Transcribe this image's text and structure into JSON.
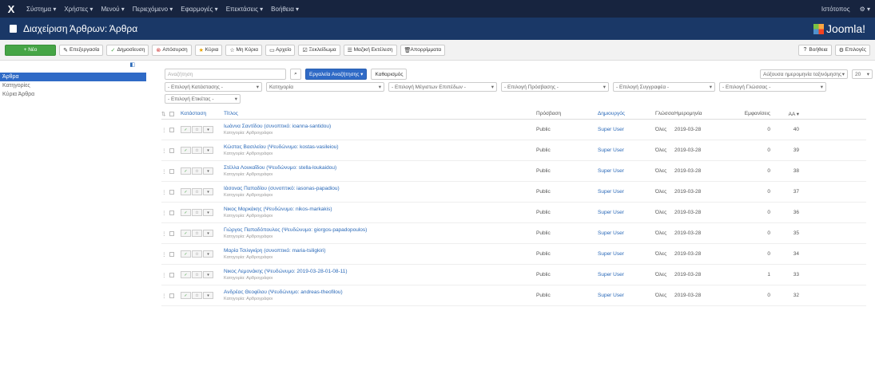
{
  "topnav": {
    "logo": "X",
    "menus": [
      "Σύστημα ▾",
      "Χρήστες ▾",
      "Μενού ▾",
      "Περιεχόμενο ▾",
      "Εφαρμογές ▾",
      "Επεκτάσεις ▾",
      "Βοήθεια ▾"
    ],
    "site": "Ιστότοπος",
    "gear": "⚙ ▾"
  },
  "header": {
    "title": "Διαχείριση Άρθρων: Άρθρα",
    "brand": "Joomla!"
  },
  "toolbar": {
    "new": "+ Νέο",
    "edit": "Επεξεργασία",
    "publish": "Δημοσίευση",
    "unpublish": "Απόσυρση",
    "featured": "Κύρια",
    "unfeatured": "Μη Κύρια",
    "archive": "Αρχείο",
    "checkin": "Ξεκλείδωμα",
    "batch": "Μαζική Εκτέλεση",
    "trash": "Απορρίμματα",
    "help": "Βοήθεια",
    "options": "Επιλογές"
  },
  "sidebar": {
    "toggle": "◧",
    "items": [
      "Άρθρα",
      "Κατηγορίες",
      "Κύρια Άρθρα"
    ]
  },
  "filters": {
    "search_placeholder": "Αναζήτηση",
    "search_tools": "Εργαλεία Αναζήτησης ▾",
    "clear": "Καθαρισμός",
    "ordering": "Αύξουσα ημερομηνία ταξινόμησης",
    "limit": "20",
    "sel1": "- Επιλογή Κατάστασης -",
    "sel2": "Κατηγορία",
    "sel3": "- Επιλογή Μέγιστων Επιπέδων -",
    "sel4": "- Επιλογή Πρόσβασης -",
    "sel5": "- Επιλογή Συγγραφέα -",
    "sel6": "- Επιλογή Γλώσσας -",
    "sel7": "- Επιλογή Ετικέτας -"
  },
  "columns": {
    "status": "Κατάσταση",
    "title": "Τίτλος",
    "access": "Πρόσβαση",
    "author": "Δημιουργός",
    "language": "Γλώσσα",
    "date": "Ημερομηνία",
    "hits": "Εμφανίσεις",
    "id": "ΑΑ ▾"
  },
  "rows": [
    {
      "title": "Ιωάννα Σαντίδου (συνοπτικό: ioanna-santidou)",
      "sub": "Κατηγορία: Αρθρογράφοι",
      "access": "Public",
      "author": "Super User",
      "lang": "Όλες",
      "date": "2019-03-28",
      "hits": "0",
      "id": "40"
    },
    {
      "title": "Κώστας Βασιλείου (Ψευδώνυμο: kostas-vasileiou)",
      "sub": "Κατηγορία: Αρθρογράφοι",
      "access": "Public",
      "author": "Super User",
      "lang": "Όλες",
      "date": "2019-03-28",
      "hits": "0",
      "id": "39"
    },
    {
      "title": "Στέλλα Λουκαΐδου (Ψευδώνυμο: stella-loukaidou)",
      "sub": "Κατηγορία: Αρθρογράφοι",
      "access": "Public",
      "author": "Super User",
      "lang": "Όλες",
      "date": "2019-03-28",
      "hits": "0",
      "id": "38"
    },
    {
      "title": "Ιάσονας Παπαδίου (συνοπτικό: iasonas-papadiou)",
      "sub": "Κατηγορία: Αρθρογράφοι",
      "access": "Public",
      "author": "Super User",
      "lang": "Όλες",
      "date": "2019-03-28",
      "hits": "0",
      "id": "37"
    },
    {
      "title": "Νικος Μαρκάκης (Ψευδώνυμο: nikos-markakis)",
      "sub": "Κατηγορία: Αρθρογράφοι",
      "access": "Public",
      "author": "Super User",
      "lang": "Όλες",
      "date": "2019-03-28",
      "hits": "0",
      "id": "36"
    },
    {
      "title": "Γιώργος Παπαδόπουλος (Ψευδώνυμο: giorgos-papadopoulos)",
      "sub": "Κατηγορία: Αρθρογράφοι",
      "access": "Public",
      "author": "Super User",
      "lang": "Όλες",
      "date": "2019-03-28",
      "hits": "0",
      "id": "35"
    },
    {
      "title": "Μαρία Τσιλιγκίρη (συνοπτικό: maria-tsiligkiri)",
      "sub": "Κατηγορία: Αρθρογράφοι",
      "access": "Public",
      "author": "Super User",
      "lang": "Όλες",
      "date": "2019-03-28",
      "hits": "0",
      "id": "34"
    },
    {
      "title": "Νικος Λεμονάκης (Ψευδώνυμο: 2019-03-28-01-08-11)",
      "sub": "Κατηγορία: Αρθρογράφοι",
      "access": "Public",
      "author": "Super User",
      "lang": "Όλες",
      "date": "2019-03-28",
      "hits": "1",
      "id": "33"
    },
    {
      "title": "Ανδρέας Θεοφίλου (Ψευδώνυμο: andreas-theofilou)",
      "sub": "Κατηγορία: Αρθρογράφοι",
      "access": "Public",
      "author": "Super User",
      "lang": "Όλες",
      "date": "2019-03-28",
      "hits": "0",
      "id": "32"
    }
  ]
}
